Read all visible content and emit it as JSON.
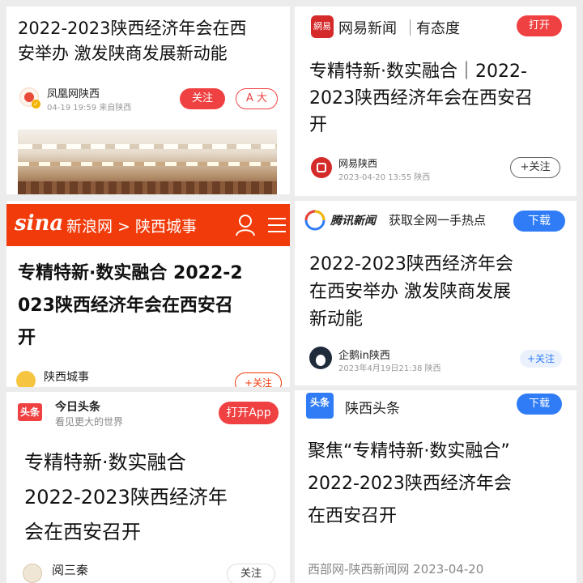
{
  "p1": {
    "headline_line1": "2022-2023陕西经济年会在西",
    "headline_line2": "安举办 激发陕商发展新动能",
    "author": "凤凰网陕西",
    "meta": "04-19 19:59 来自陕西",
    "follow_label": "关注",
    "font_label": "A 大",
    "colors": {
      "accent": "#f04142"
    }
  },
  "p2": {
    "app_logo_text": "網易",
    "app_name": "网易新闻",
    "slogan": "有态度",
    "open_label": "打开",
    "headline_line1": "专精特新·数实融合｜2022-",
    "headline_line2": "2023陕西经济年会在西安召",
    "headline_line3": "开",
    "author": "网易陕西",
    "meta": "2023-04-20 13:55 陕西",
    "follow_label": "+关注"
  },
  "p3": {
    "logo_text": "sina",
    "nav": "新浪网 > 陕西城事",
    "headline_line1": "专精特新·数实融合 2022-2",
    "headline_line2": "023陕西经济年会在西安召",
    "headline_line3": "开",
    "author": "陕西城事",
    "follow_label": "+关注"
  },
  "p4": {
    "brand": "腾讯新闻",
    "tagline": "获取全网一手热点",
    "download_label": "下载",
    "headline_line1": "2022-2023陕西经济年会",
    "headline_line2": "在西安举办 激发陕商发展",
    "headline_line3": "新动能",
    "author": "企鹅in陕西",
    "meta": "2023年4月19日21:38 陕西",
    "follow_label": "+关注"
  },
  "p5": {
    "logo_text": "头条",
    "app_name": "今日头条",
    "slogan": "看见更大的世界",
    "open_label": "打开App",
    "headline_line1": "专精特新·数实融合",
    "headline_line2": "2022-2023陕西经济年",
    "headline_line3": "会在西安召开",
    "author": "阅三秦",
    "follow_label": "关注"
  },
  "p6": {
    "logo_text": "头条",
    "app_name": "陕西头条",
    "download_label": "下载",
    "headline_line1": "聚焦“专精特新·数实融合”",
    "headline_line2": "2022-2023陕西经济年会",
    "headline_line3": "在西安召开",
    "source": "西部网-陕西新闻网 2023-04-20"
  }
}
